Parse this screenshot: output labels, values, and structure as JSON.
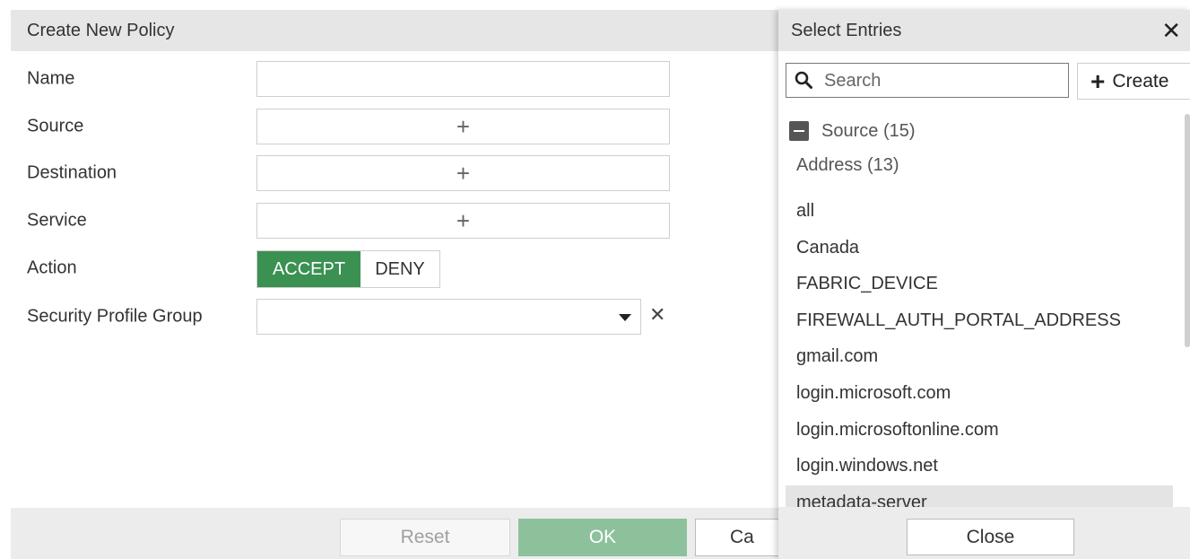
{
  "dialog": {
    "title": "Create New Policy",
    "fields": {
      "name_label": "Name",
      "name_value": "",
      "source_label": "Source",
      "destination_label": "Destination",
      "service_label": "Service",
      "action_label": "Action",
      "security_profile_label": "Security Profile Group",
      "security_profile_value": ""
    },
    "action": {
      "accept_label": "ACCEPT",
      "deny_label": "DENY",
      "selected": "ACCEPT"
    },
    "footer": {
      "reset_label": "Reset",
      "ok_label": "OK",
      "cancel_label": "Ca"
    },
    "colors": {
      "accept_bg": "#3a9152",
      "ok_bg": "#8dc19b"
    }
  },
  "panel": {
    "title": "Select Entries",
    "search": {
      "placeholder": "Search",
      "value": ""
    },
    "create_label": "Create",
    "group": {
      "label": "Source",
      "count": "(15)"
    },
    "subgroup": {
      "label": "Address",
      "count": "(13)"
    },
    "entries": [
      "all",
      "Canada",
      "FABRIC_DEVICE",
      "FIREWALL_AUTH_PORTAL_ADDRESS",
      "gmail.com",
      "login.microsoft.com",
      "login.microsoftonline.com",
      "login.windows.net",
      "metadata-server"
    ],
    "highlighted_entry": "metadata-server",
    "close_label": "Close"
  },
  "icons": [
    "plus-icon",
    "caret-down-icon",
    "clear-icon",
    "close-icon",
    "search-icon",
    "collapse-icon"
  ]
}
